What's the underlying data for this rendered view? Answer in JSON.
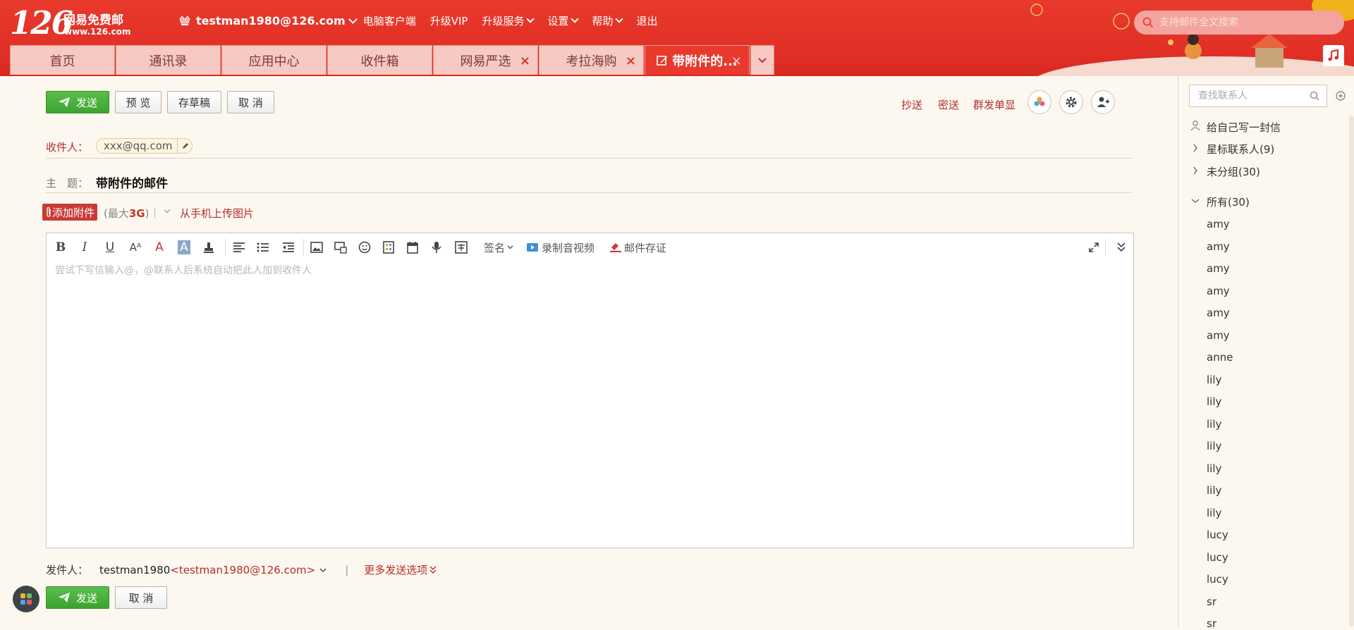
{
  "brand": {
    "number": "126",
    "name": "网易免费邮",
    "url": "www.126.com"
  },
  "topnav": {
    "email": "testman1980@126.com",
    "items": [
      "电脑客户端",
      "升级VIP",
      "升级服务",
      "设置",
      "帮助",
      "退出"
    ]
  },
  "search": {
    "placeholder": "支持邮件全文搜索"
  },
  "tabs": [
    "首页",
    "通讯录",
    "应用中心",
    "收件箱",
    "网易严选",
    "考拉海购",
    "带附件的..."
  ],
  "actions": {
    "send": "发送",
    "preview": "预 览",
    "draft": "存草稿",
    "cancel": "取 消"
  },
  "right_links": {
    "cc": "抄送",
    "bcc": "密送",
    "separate": "群发单显"
  },
  "recipient": {
    "label": "收件人：",
    "chip": "xxx@qq.com"
  },
  "subject": {
    "label": "主　题：",
    "value": "带附件的邮件"
  },
  "attachment": {
    "button": "添加附件",
    "info_prefix": "(最大",
    "info_size": "3G",
    "info_suffix": ")",
    "mobile": "从手机上传图片"
  },
  "editor": {
    "toolbar": {
      "signature": "签名",
      "record": "录制音视频",
      "evidence": "邮件存证"
    },
    "placeholder": "尝试下写信输入@，@联系人后系统自动把此人加到收件人"
  },
  "sender": {
    "label": "发件人：",
    "name": "testman1980",
    "email": "<testman1980@126.com>",
    "more": "更多发送选项"
  },
  "contacts": {
    "search_placeholder": "查找联系人",
    "write_self": "给自己写一封信",
    "groups": [
      "星标联系人(9)",
      "未分组(30)",
      "所有(30)"
    ],
    "items": [
      "amy",
      "amy",
      "amy",
      "amy",
      "amy",
      "amy",
      "anne",
      "lily",
      "lily",
      "lily",
      "lily",
      "lily",
      "lily",
      "lily",
      "lucy",
      "lucy",
      "lucy",
      "sr",
      "sr"
    ]
  }
}
